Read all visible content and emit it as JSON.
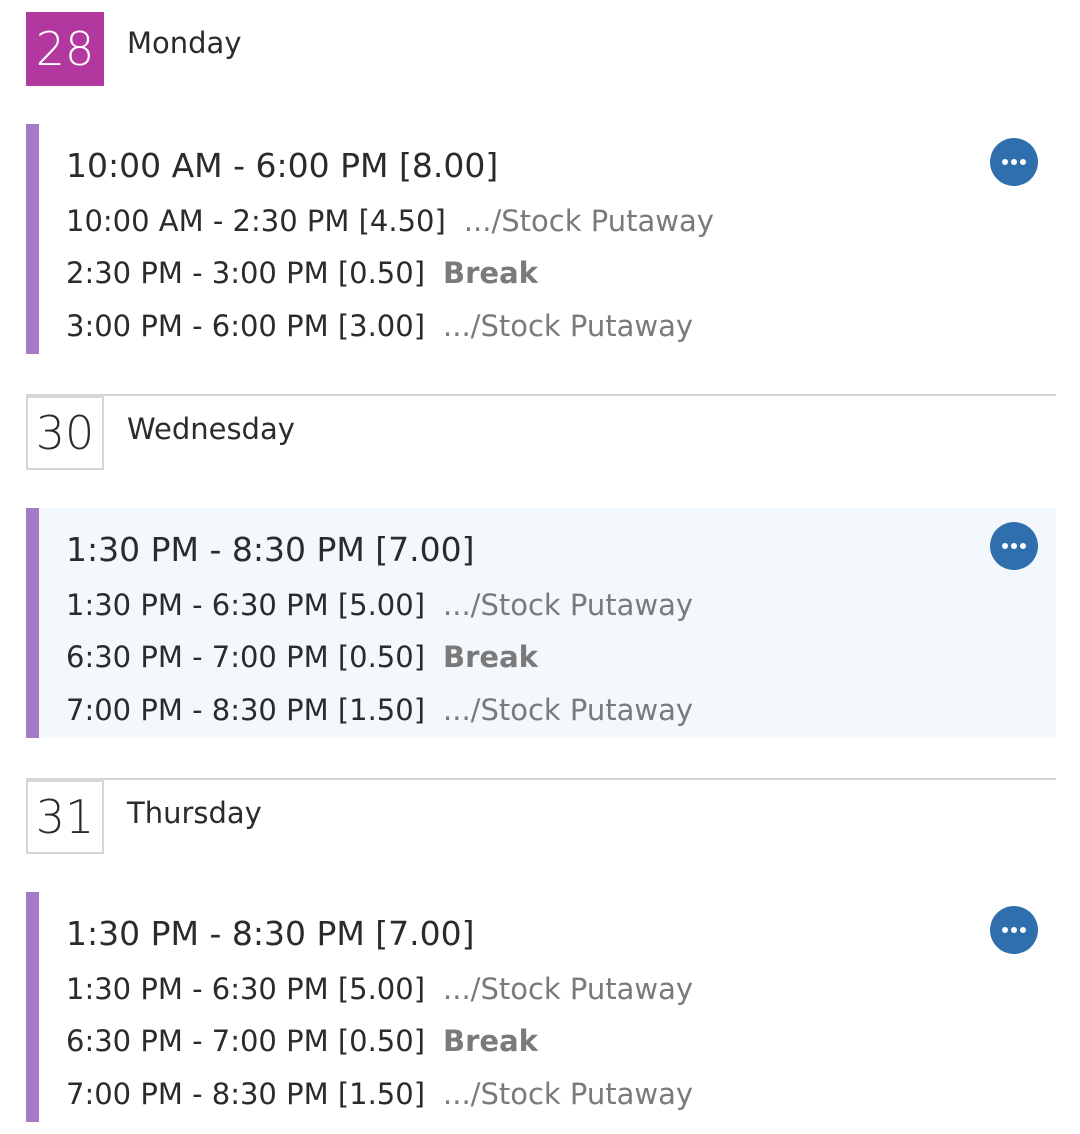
{
  "accent_colors": {
    "today_badge": "#b2379f",
    "shift_bar": "#a57ac8",
    "more_button": "#2f6fae",
    "highlight_bg": "#f3f8fd"
  },
  "days": [
    {
      "date": "28",
      "day_name": "Monday",
      "is_today": true,
      "shift": {
        "total": "10:00 AM - 6:00 PM [8.00]",
        "more_icon": "ellipsis-icon",
        "segments": [
          {
            "time": "10:00 AM - 2:30 PM [4.50]",
            "task": ".../Stock Putaway"
          },
          {
            "time": "2:30 PM - 3:00 PM [0.50]",
            "task": "Break"
          },
          {
            "time": "3:00 PM - 6:00 PM [3.00]",
            "task": ".../Stock Putaway"
          }
        ]
      }
    },
    {
      "date": "30",
      "day_name": "Wednesday",
      "is_today": false,
      "shift": {
        "total": "1:30 PM - 8:30 PM [7.00]",
        "more_icon": "ellipsis-icon",
        "segments": [
          {
            "time": "1:30 PM - 6:30 PM [5.00]",
            "task": ".../Stock Putaway"
          },
          {
            "time": "6:30 PM - 7:00 PM [0.50]",
            "task": "Break"
          },
          {
            "time": "7:00 PM - 8:30 PM [1.50]",
            "task": ".../Stock Putaway"
          }
        ]
      }
    },
    {
      "date": "31",
      "day_name": "Thursday",
      "is_today": false,
      "shift": {
        "total": "1:30 PM - 8:30 PM [7.00]",
        "more_icon": "ellipsis-icon",
        "segments": [
          {
            "time": "1:30 PM - 6:30 PM [5.00]",
            "task": ".../Stock Putaway"
          },
          {
            "time": "6:30 PM - 7:00 PM [0.50]",
            "task": "Break"
          },
          {
            "time": "7:00 PM - 8:30 PM [1.50]",
            "task": ".../Stock Putaway"
          }
        ]
      }
    }
  ]
}
